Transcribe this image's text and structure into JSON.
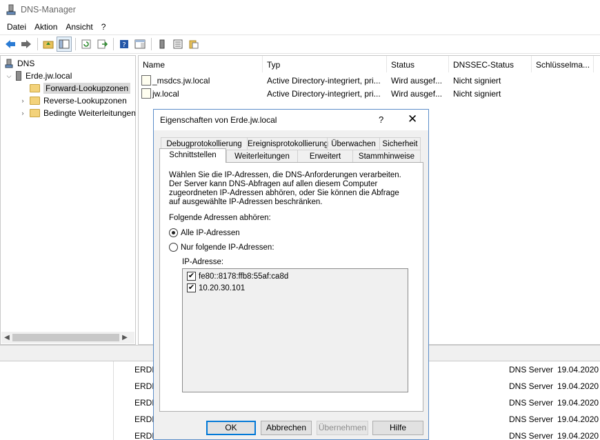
{
  "window": {
    "title": "DNS-Manager"
  },
  "menu": [
    "Datei",
    "Aktion",
    "Ansicht",
    "?"
  ],
  "toolbar_icons": [
    "back-arrow-icon",
    "forward-arrow-icon",
    "up-folder-icon",
    "show-hide-tree-icon",
    "refresh-icon",
    "export-list-icon",
    "help-icon",
    "properties-pane-icon",
    "server-icon",
    "list-icon",
    "clipboard-icon"
  ],
  "tree": {
    "root": "DNS",
    "server": "Erde.jw.local",
    "items": [
      "Forward-Lookupzonen",
      "Reverse-Lookupzonen",
      "Bedingte Weiterleitungen"
    ]
  },
  "list": {
    "columns": [
      "Name",
      "Typ",
      "Status",
      "DNSSEC-Status",
      "Schlüsselma..."
    ],
    "rows": [
      {
        "name": "_msdcs.jw.local",
        "type": "Active Directory-integriert, pri...",
        "status": "Wird ausgef...",
        "dnssec": "Nicht signiert"
      },
      {
        "name": "jw.local",
        "type": "Active Directory-integriert, pri...",
        "status": "Wird ausgef...",
        "dnssec": "Nicht signiert"
      }
    ]
  },
  "log": {
    "rows": [
      {
        "computer": "ERDE",
        "source": "DNS Server",
        "date": "19.04.2020"
      },
      {
        "computer": "ERDE",
        "source": "DNS Server",
        "date": "19.04.2020"
      },
      {
        "computer": "ERDE",
        "source": "DNS Server",
        "date": "19.04.2020"
      },
      {
        "computer": "ERDE",
        "source": "DNS Server",
        "date": "19.04.2020"
      },
      {
        "computer": "ERDE",
        "source": "DNS Server",
        "date": "19.04.2020"
      }
    ]
  },
  "dialog": {
    "title": "Eigenschaften von Erde.jw.local",
    "help_glyph": "?",
    "close_glyph": "✕",
    "tabs_row1": [
      "Debugprotokollierung",
      "Ereignisprotokollierung",
      "Überwachen",
      "Sicherheit"
    ],
    "tabs_row2": [
      "Schnittstellen",
      "Weiterleitungen",
      "Erweitert",
      "Stammhinweise"
    ],
    "active_tab": "Schnittstellen",
    "description": "Wählen Sie die IP-Adressen, die DNS-Anforderungen verarbeiten. Der Server kann DNS-Abfragen auf allen diesem Computer zugeordneten IP-Adressen abhören, oder Sie können die Abfrage auf ausgewählte IP-Adressen beschränken.",
    "listen_label": "Folgende Adressen abhören:",
    "option_all": "Alle IP-Adressen",
    "option_only": "Nur folgende IP-Adressen:",
    "selected_option": "Alle IP-Adressen",
    "ip_label": "IP-Adresse:",
    "ip_addresses": [
      {
        "address": "fe80::8178:ffb8:55af:ca8d",
        "checked": true
      },
      {
        "address": "10.20.30.101",
        "checked": true
      }
    ],
    "buttons": {
      "ok": "OK",
      "cancel": "Abbrechen",
      "apply": "Übernehmen",
      "help": "Hilfe"
    }
  }
}
